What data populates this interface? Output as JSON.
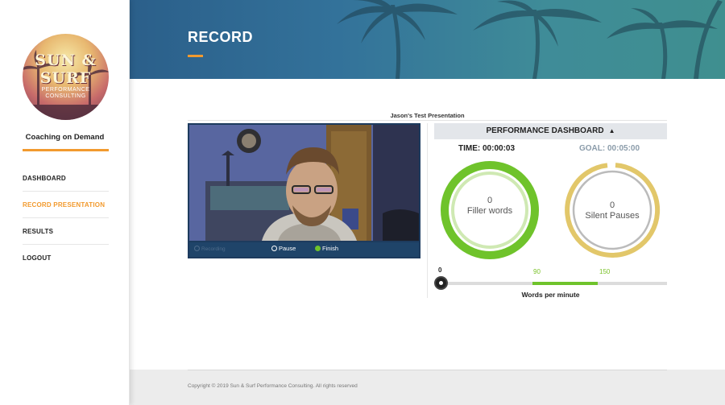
{
  "brand": {
    "logo_line1": "SUN & SURF",
    "logo_line2": "PERFORMANCE CONSULTING",
    "tagline": "Coaching on Demand",
    "accent_color": "#f29a2e"
  },
  "sidebar": {
    "items": [
      {
        "label": "DASHBOARD",
        "active": false
      },
      {
        "label": "RECORD PRESENTATION",
        "active": true
      },
      {
        "label": "RESULTS",
        "active": false
      },
      {
        "label": "LOGOUT",
        "active": false
      }
    ]
  },
  "header": {
    "title": "RECORD"
  },
  "presentation": {
    "title": "Jason's Test Presentation"
  },
  "video": {
    "recording_label": "Recording",
    "pause_label": "Pause",
    "finish_label": "Finish"
  },
  "dashboard": {
    "heading": "PERFORMANCE DASHBOARD",
    "time_label": "TIME: 00:00:03",
    "goal_label": "GOAL: 00:05:00",
    "filler": {
      "count": "0",
      "label": "Filler words",
      "color": "#6fc32b"
    },
    "silent": {
      "count": "0",
      "label": "Silent Pauses",
      "color": "#e2c76a"
    },
    "wpm": {
      "current": "0",
      "low": "90",
      "high": "150",
      "label": "Words per minute",
      "zone_color": "#6fc32b"
    }
  },
  "footer": {
    "copyright": "Copyright © 2019 Sun & Surf Performance Consulting. All rights reserved"
  }
}
